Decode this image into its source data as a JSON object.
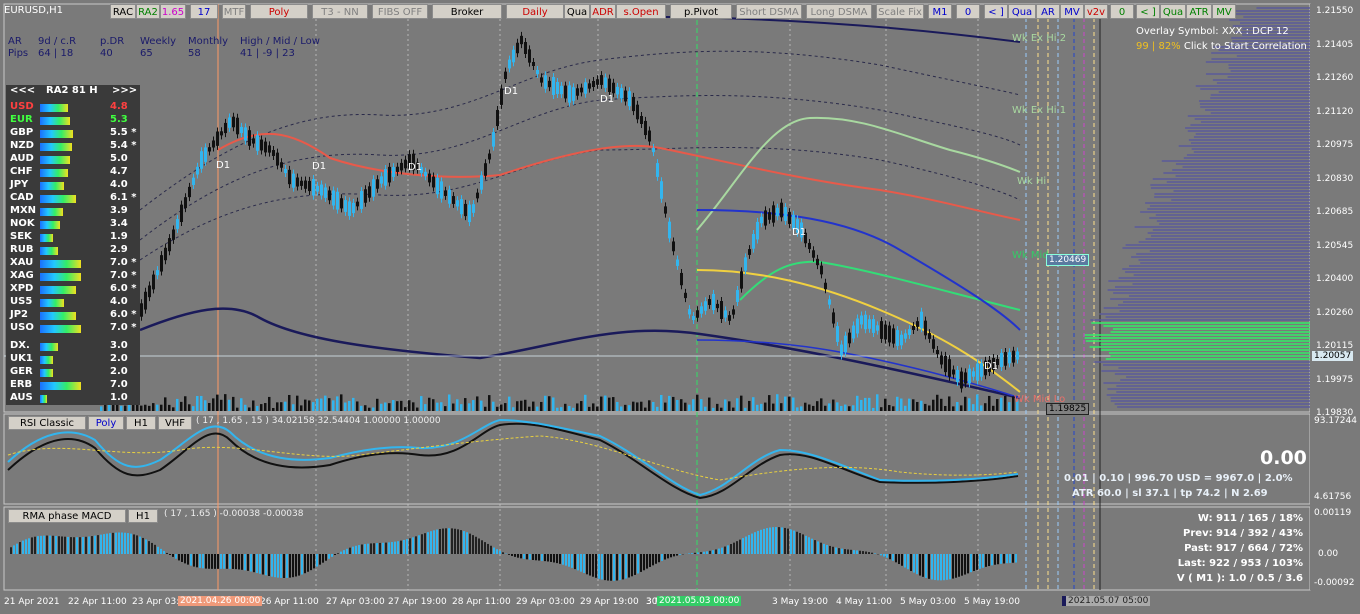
{
  "symbol": "EURUSD,H1",
  "toolbar": {
    "buttons": [
      {
        "label": "RAC",
        "color": "#000000"
      },
      {
        "label": "RA2",
        "color": "#008000"
      },
      {
        "label": "1.65",
        "color": "#cc00cc"
      },
      {
        "label": "17",
        "color": "#0000cc"
      },
      {
        "label": "MTF",
        "color": "#808080"
      },
      {
        "label": "Poly",
        "color": "#cc0000"
      },
      {
        "label": "T3 - NN",
        "color": "#808080"
      },
      {
        "label": "FIBS OFF",
        "color": "#808080"
      },
      {
        "label": "Broker",
        "color": "#000000"
      },
      {
        "label": "Daily",
        "color": "#cc0000"
      },
      {
        "label": "Qua",
        "color": "#000000"
      },
      {
        "label": "ADR",
        "color": "#cc0000"
      },
      {
        "label": "s.Open",
        "color": "#cc0000"
      },
      {
        "label": "p.Pivot",
        "color": "#000000"
      },
      {
        "label": "Short DSMA",
        "color": "#808080"
      },
      {
        "label": "Long DSMA",
        "color": "#808080"
      },
      {
        "label": "Scale Fix",
        "color": "#808080"
      },
      {
        "label": "M1",
        "color": "#0000cc"
      },
      {
        "label": "0",
        "color": "#0000cc"
      },
      {
        "label": "< ]",
        "color": "#0000cc"
      },
      {
        "label": "Qua",
        "color": "#0000cc"
      },
      {
        "label": "AR",
        "color": "#0000cc"
      },
      {
        "label": "MV",
        "color": "#0000cc"
      },
      {
        "label": "v2v",
        "color": "#cc0000"
      },
      {
        "label": "0",
        "color": "#008000"
      },
      {
        "label": "< ]",
        "color": "#008000"
      },
      {
        "label": "Qua",
        "color": "#008000"
      },
      {
        "label": "ATR",
        "color": "#008000"
      },
      {
        "label": "MV",
        "color": "#008000"
      }
    ]
  },
  "stats": {
    "row1": [
      "AR",
      "9d / c.R",
      "p.DR",
      "Weekly",
      "Monthly",
      "High / Mid / Low"
    ],
    "row2": [
      "Pips",
      "64 | 18",
      "40",
      "65",
      "58",
      "41 | -9 | 23"
    ]
  },
  "overlay": {
    "line1": "Overlay Symbol: XXX : DCP 12",
    "line2a": "99 | 82%",
    "line2b": "Click to Start Correlation"
  },
  "heatmap": {
    "header": [
      "<<<",
      "RA2 81 H",
      ">>>"
    ],
    "rows": [
      {
        "name": "USD",
        "value": "4.8",
        "color": "#ff4040",
        "bar": 0.55
      },
      {
        "name": "EUR",
        "value": "5.3",
        "color": "#40ff40",
        "bar": 0.6
      },
      {
        "name": "GBP",
        "value": "5.5 *",
        "color": "#ffffff",
        "bar": 0.65
      },
      {
        "name": "NZD",
        "value": "5.4 *",
        "color": "#ffffff",
        "bar": 0.63
      },
      {
        "name": "AUD",
        "value": "5.0",
        "color": "#ffffff",
        "bar": 0.6
      },
      {
        "name": "CHF",
        "value": "4.7",
        "color": "#ffffff",
        "bar": 0.55
      },
      {
        "name": "JPY",
        "value": "4.0",
        "color": "#ffffff",
        "bar": 0.48
      },
      {
        "name": "CAD",
        "value": "6.1 *",
        "color": "#ffffff",
        "bar": 0.72
      },
      {
        "name": "MXN",
        "value": "3.9",
        "color": "#ffffff",
        "bar": 0.46
      },
      {
        "name": "NOK",
        "value": "3.4",
        "color": "#ffffff",
        "bar": 0.4
      },
      {
        "name": "SEK",
        "value": "1.9",
        "color": "#ffffff",
        "bar": 0.25
      },
      {
        "name": "RUB",
        "value": "2.9",
        "color": "#ffffff",
        "bar": 0.35
      },
      {
        "name": "XAU",
        "value": "7.0 *",
        "color": "#ffffff",
        "bar": 0.82
      },
      {
        "name": "XAG",
        "value": "7.0 *",
        "color": "#ffffff",
        "bar": 0.82
      },
      {
        "name": "XPD",
        "value": "6.0 *",
        "color": "#ffffff",
        "bar": 0.72
      },
      {
        "name": "US5",
        "value": "4.0",
        "color": "#ffffff",
        "bar": 0.48
      },
      {
        "name": "JP2",
        "value": "6.0 *",
        "color": "#ffffff",
        "bar": 0.72
      },
      {
        "name": "USO",
        "value": "7.0 *",
        "color": "#ffffff",
        "bar": 0.82
      },
      {
        "name": "DX.",
        "value": "3.0",
        "color": "#ffffff",
        "bar": 0.36
      },
      {
        "name": "UK1",
        "value": "2.0",
        "color": "#ffffff",
        "bar": 0.26
      },
      {
        "name": "GER",
        "value": "2.0",
        "color": "#ffffff",
        "bar": 0.26
      },
      {
        "name": "ERB",
        "value": "7.0",
        "color": "#ffffff",
        "bar": 0.82
      },
      {
        "name": "AUS",
        "value": "1.0",
        "color": "#ffffff",
        "bar": 0.14
      }
    ]
  },
  "price_axis": [
    "1.21550",
    "1.21405",
    "1.21260",
    "1.21120",
    "1.20975",
    "1.20830",
    "1.20685",
    "1.20545",
    "1.20400",
    "1.20260",
    "1.20115",
    "1.19975",
    "1.19830"
  ],
  "price_current": "1.20057",
  "price_low_tag": "1.19825",
  "price_mid_tag": "1.20469",
  "levels": [
    "Wk Ex Hi 2",
    "Wk Ex Hi 1",
    "Wk Hi",
    "Wk Mid",
    "Wk Mid Lo"
  ],
  "date_axis": [
    "21 Apr 2021",
    "22 Apr 11:00",
    "23 Apr 03:",
    "26 Apr 11:00",
    "27 Apr 03:00",
    "27 Apr 19:00",
    "28 Apr 11:00",
    "29 Apr 03:00",
    "29 Apr 19:00",
    "30",
    "3 May 11:00",
    "3 May 19:00",
    "4 May 11:00",
    "5 May 03:00",
    "5 May 19:00"
  ],
  "date_tags": [
    "2021.04.26 00:00",
    "2021.05.03 00:00",
    "2021.05.07 05:00"
  ],
  "rsi": {
    "buttons": [
      "RSI Classic",
      "Poly",
      "H1",
      "VHF"
    ],
    "params": "( 17 , 1.65 , 15 ) 34.02158 32.54404 1.00000 1.00000",
    "axis_top": "93.17244",
    "axis_bottom": "4.61756",
    "big_value": "0.00",
    "line1": "0.01  |  0.10  |  996.70 USD = 9967.0  |  2.0%",
    "line2": "ATR 60.0  |  sl 37.1  |  tp 74.2  |  N 2.69"
  },
  "macd": {
    "buttons": [
      "RMA phase MACD",
      "H1"
    ],
    "params": "( 17 , 1.65 ) -0.00038 -0.00038",
    "axis_top": "0.00119",
    "axis_mid": "0.00",
    "axis_bottom": "-0.00092",
    "stats": [
      "W: 911 / 165 / 18%",
      "Prev: 914 / 392 / 43%",
      "Past: 917 / 664 / 72%",
      "Last: 922 / 953 / 103%",
      "V ( M1 ): 1.0 / 0.5 / 3.6"
    ]
  },
  "d1_labels": [
    "D1",
    "D1",
    "D1",
    "D1",
    "D1",
    "D1",
    "D1"
  ]
}
